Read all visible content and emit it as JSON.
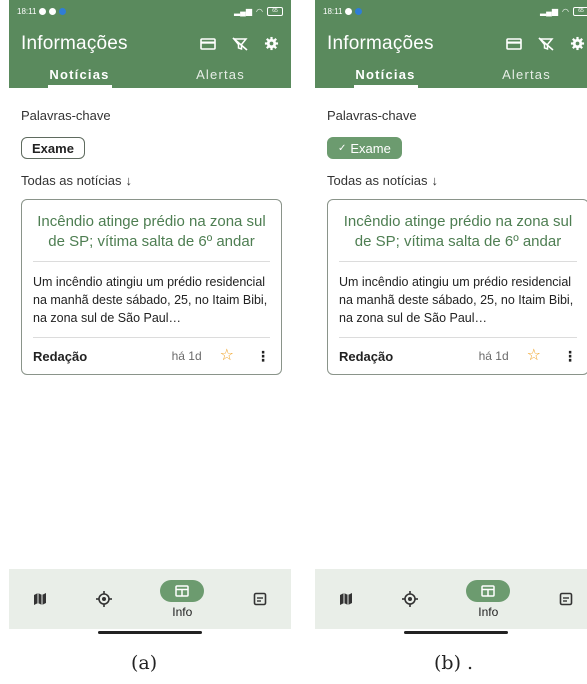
{
  "screens": [
    {
      "status": {
        "time": "18:11",
        "battery": "65"
      },
      "title": "Informações",
      "tabs": [
        "Notícias",
        "Alertas"
      ],
      "keywords_label": "Palavras-chave",
      "chip_label": "Exame",
      "chip_selected": false,
      "all_news_label": "Todas as notícias",
      "card": {
        "title": "Incêndio atinge prédio na zona sul de SP; vítima salta de 6º andar",
        "summary": "Um incêndio atingiu um prédio residencial na manhã deste sábado, 25, no Itaim Bibi, na zona sul de São Paul…",
        "source": "Redação",
        "time": "há 1d"
      },
      "nav": {
        "info_label": "Info"
      },
      "caption": "(a)"
    },
    {
      "status": {
        "time": "18:11",
        "battery": "65"
      },
      "title": "Informações",
      "tabs": [
        "Notícias",
        "Alertas"
      ],
      "keywords_label": "Palavras-chave",
      "chip_label": "Exame",
      "chip_selected": true,
      "all_news_label": "Todas as notícias",
      "card": {
        "title": "Incêndio atinge prédio na zona sul de SP; vítima salta de 6º andar",
        "summary": "Um incêndio atingiu um prédio residencial na manhã deste sábado, 25, no Itaim Bibi, na zona sul de São Paul…",
        "source": "Redação",
        "time": "há 1d"
      },
      "nav": {
        "info_label": "Info"
      },
      "caption": "(b) ."
    }
  ],
  "colors": {
    "primary": "#5a8a5d",
    "chip_selected": "#6c9b6f",
    "title_green": "#4e7e52",
    "star": "#f0a020",
    "nav_bg": "#e9eee8"
  },
  "icons": [
    "card-icon",
    "filter-off-icon",
    "gear-icon",
    "map-icon",
    "location-icon",
    "info-icon",
    "document-icon",
    "star-outline-icon",
    "more-vert-icon",
    "arrow-down-icon"
  ]
}
